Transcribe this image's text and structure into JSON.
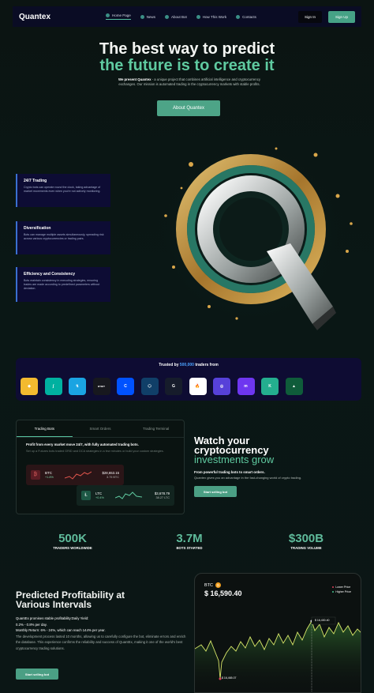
{
  "nav": {
    "logo": "Quantex",
    "links": [
      "Home Page",
      "News",
      "About Bot",
      "How This Work",
      "Contacts"
    ],
    "sign_in": "Sign In",
    "sign_up": "Sign Up"
  },
  "hero": {
    "title_line1": "The best way to predict",
    "title_line2": "the future is to create it",
    "sub_bold": "We present Quantex",
    "sub_rest": " - a unique project that combines artificial intelligence and cryptocurrency exchanges. Our mission is automated trading in the cryptocurrency markets with stable profits.",
    "cta": "About Quantex"
  },
  "features": [
    {
      "title": "24/7 Trading",
      "text": "Crypto bots can operate round the clock, taking advantage of market movements even when you're not actively monitoring."
    },
    {
      "title": "Diversification",
      "text": "Bots can manage multiple assets simultaneously, spreading risk across various cryptocurrencies or trading pairs."
    },
    {
      "title": "Efficiency and Consistency",
      "text": "Bots maintain consistency in executing strategies, ensuring trades are made according to predefined parameters without deviation."
    }
  ],
  "trusted": {
    "prefix": "Trusted by ",
    "highlight": "500,000",
    "suffix": " traders from",
    "exchanges": [
      {
        "name": "binance",
        "color": "#f3ba2f",
        "glyph": "◆"
      },
      {
        "name": "bitget",
        "color": "#00b1a0",
        "glyph": "∫"
      },
      {
        "name": "bitstamp",
        "color": "#1aa4e2",
        "glyph": "↯"
      },
      {
        "name": "bybit",
        "color": "#17181e",
        "glyph": "BYBIT"
      },
      {
        "name": "coinbase",
        "color": "#0052ff",
        "glyph": "C"
      },
      {
        "name": "crypto-com",
        "color": "#103f68",
        "glyph": "⬡"
      },
      {
        "name": "gate-io",
        "color": "#161c2b",
        "glyph": "G"
      },
      {
        "name": "huobi",
        "color": "#ffffff",
        "glyph": "🔥"
      },
      {
        "name": "kraken",
        "color": "#5741d9",
        "glyph": "◎"
      },
      {
        "name": "kucoin",
        "color": "#6e36f0",
        "glyph": "m"
      },
      {
        "name": "kucoin-k",
        "color": "#24ae8f",
        "glyph": "K"
      },
      {
        "name": "okx",
        "color": "#0f5c3a",
        "glyph": "▲"
      }
    ]
  },
  "bots": {
    "tabs": [
      "Trading Bots",
      "Smart Orders",
      "Trading Terminal"
    ],
    "title": "Profit from every market move 24/7, with fully automated trading bots.",
    "desc": "Set up a Futures bots traded GRID and DCA strategies in a few minutes or build your custom strategies.",
    "btc": {
      "name": "BTC",
      "change": "+1.8%",
      "price": "$28,653.15",
      "amount": "3.75 BTC"
    },
    "ltc": {
      "name": "LTC",
      "change": "+0.4%",
      "price": "$3,678.79",
      "amount": "38.27 LTC"
    }
  },
  "watch": {
    "line1": "Watch your",
    "line2": "cryptocurrency",
    "line3": "investments grow",
    "sub": "From powerful trading bots to smart orders.",
    "desc": "Quantex gives you an advantage in the fast-changing world of crypto trading.",
    "cta": "Start selling bot"
  },
  "stats": [
    {
      "value": "500K",
      "label": "TRADERS WORLDWIDE"
    },
    {
      "value": "3.7M",
      "label": "BOTS STARTED"
    },
    {
      "value": "$300B",
      "label": "TRADING VOLUME"
    }
  ],
  "profit": {
    "title_line1": "Predicted Profitability at",
    "title_line2": "Various Intervals",
    "p1": "QuantEx promises stable profitability:Daily Yield:",
    "p2": "0.2% - 0.8% per day.",
    "p3": "Monthly Return: 6% - 24%, which can reach 144% per year.",
    "p4": "The development process lasted 10 months, allowing us to carefully configure the bot, eliminate errors and enrich the database. This experience confirms the reliability and success of QuantEx, making it one of the world's best cryptocurrency trading solutions.",
    "cta": "Start selling bot"
  },
  "btc_chart": {
    "symbol": "BTC",
    "price": "$ 16,590.40",
    "legend_lower": "Lower Price",
    "legend_higher": "Higher Price",
    "lower_color": "#e0425c",
    "higher_color": "#45c48f",
    "high_label": "$ 16,400.40",
    "low_label": "$ 16,465.07"
  }
}
